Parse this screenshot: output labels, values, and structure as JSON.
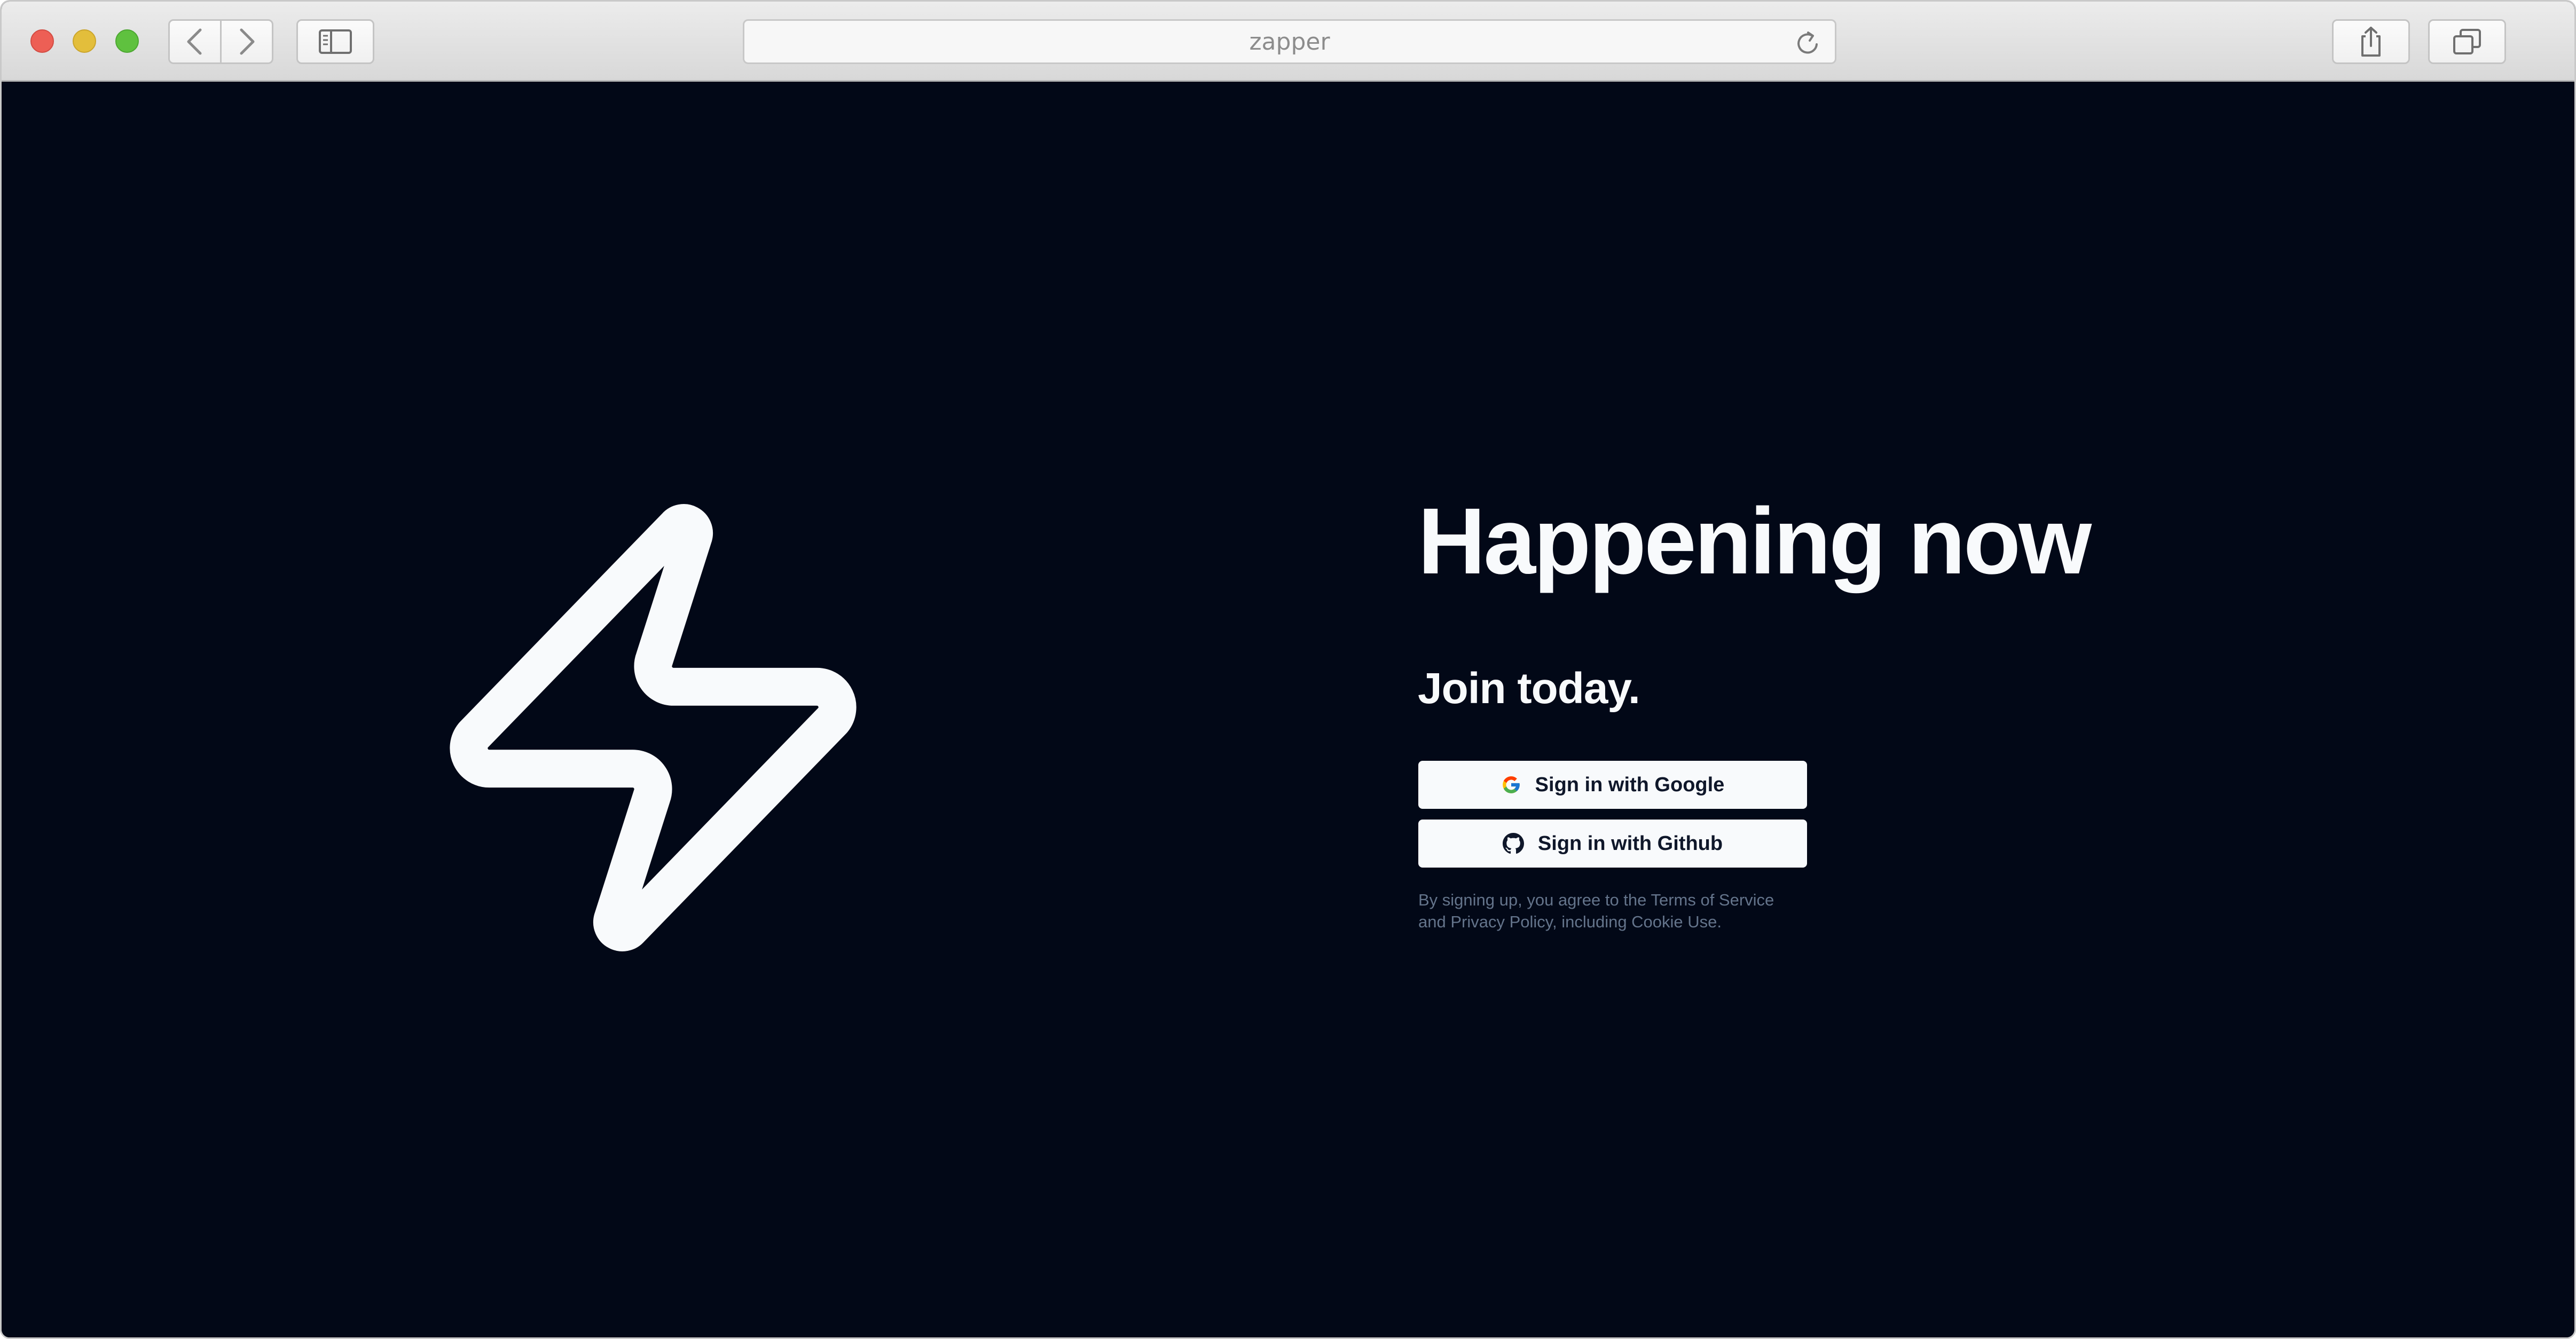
{
  "browser": {
    "address": "zapper"
  },
  "hero": {
    "title": "Happening now",
    "subtitle": "Join today."
  },
  "auth": {
    "google_label": "Sign in with Google",
    "github_label": "Sign in with Github",
    "legal_line1": "By signing up, you agree to the Terms of Service",
    "legal_line2": "and Privacy Policy, including Cookie Use."
  },
  "icons": {
    "logo": "lightning-bolt-icon",
    "google": "google-icon",
    "github": "github-icon"
  },
  "colors": {
    "background": "#020817",
    "foreground": "#f8fafc",
    "muted": "#64748b"
  }
}
